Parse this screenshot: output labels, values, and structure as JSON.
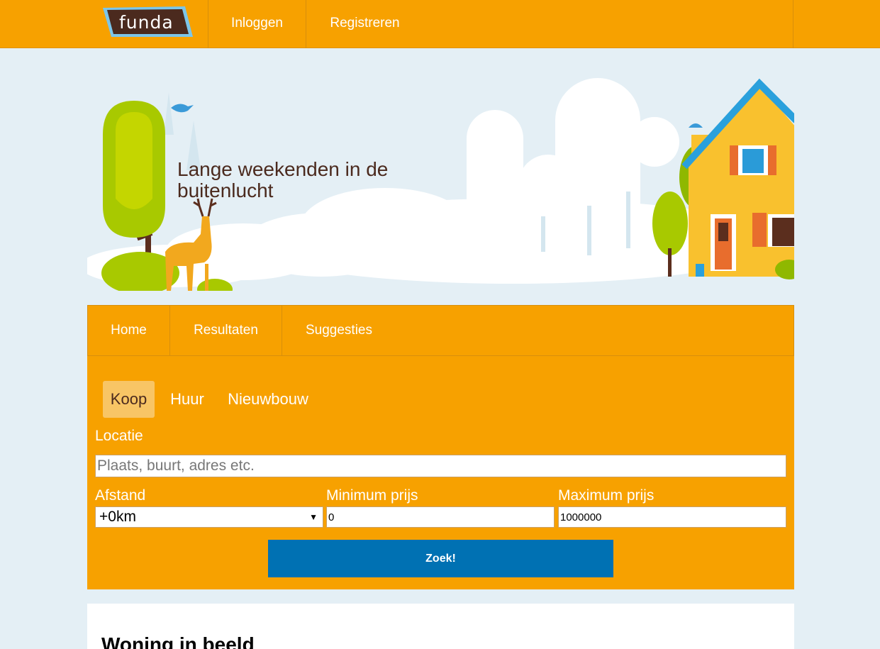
{
  "header": {
    "logo_text": "funda",
    "links": [
      "Inloggen",
      "Registreren"
    ]
  },
  "hero": {
    "title": "Lange weekenden in de buitenlucht"
  },
  "nav": {
    "tabs": [
      "Home",
      "Resultaten",
      "Suggesties"
    ]
  },
  "search": {
    "types": [
      "Koop",
      "Huur",
      "Nieuwbouw"
    ],
    "active_type": "Koop",
    "locatie_label": "Locatie",
    "locatie_placeholder": "Plaats, buurt, adres etc.",
    "afstand_label": "Afstand",
    "afstand_value": "+0km",
    "min_label": "Minimum prijs",
    "min_value": "0",
    "max_label": "Maximum prijs",
    "max_value": "1000000",
    "submit_label": "Zoek!"
  },
  "section": {
    "title": "Woning in beeld"
  },
  "colors": {
    "brand_orange": "#f7a100",
    "button_blue": "#0071b3",
    "logo_blue": "#7cc6ea",
    "logo_brown": "#4b2a1e"
  }
}
